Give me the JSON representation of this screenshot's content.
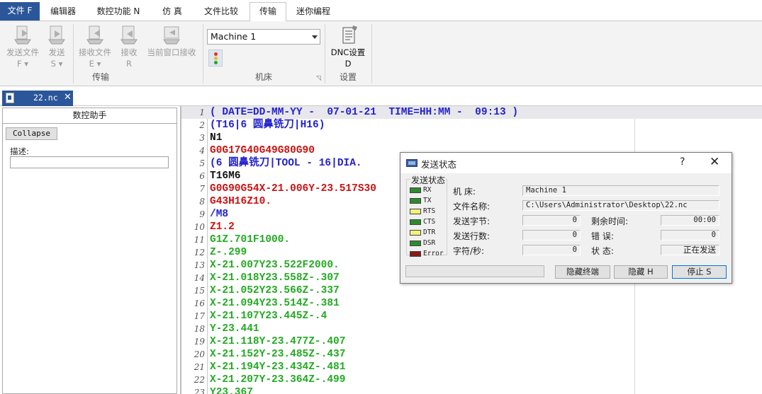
{
  "menu": {
    "tabs": [
      {
        "label": "文件 F",
        "kind": "file"
      },
      {
        "label": "编辑器"
      },
      {
        "label": "数控功能 N"
      },
      {
        "label": "仿 真"
      },
      {
        "label": "文件比较"
      },
      {
        "label": "传输",
        "active": true
      },
      {
        "label": "迷你编程"
      }
    ]
  },
  "ribbon": {
    "send_file": {
      "label": "发送文件",
      "key": "F",
      "icon": "send-file-icon"
    },
    "send": {
      "label": "发送",
      "key": "S",
      "icon": "send-icon"
    },
    "receive_file": {
      "label": "接收文件",
      "key": "E",
      "icon": "receive-file-icon"
    },
    "receive": {
      "label": "接收",
      "key": "R",
      "icon": "receive-icon"
    },
    "receive_current": {
      "label": "当前窗口接收",
      "icon": "receive-window-icon"
    },
    "group_transfer": "传输",
    "machine_value": "Machine 1",
    "group_machine": "机床",
    "dnc_settings": {
      "label": "DNC设置",
      "key": "D",
      "icon": "dnc-settings-icon"
    },
    "group_settings": "设置"
  },
  "document_tab": {
    "name": "22.nc",
    "icon": "nc-file-icon"
  },
  "assistant": {
    "title": "数控助手",
    "collapse_label": "Collapse",
    "description_label": "描述:",
    "description_value": ""
  },
  "code_lines": [
    {
      "n": "1",
      "text": "( DATE=DD-MM-YY -  07-01-21  TIME=HH:MM -  09:13 )",
      "color": "#2222cc"
    },
    {
      "n": "2",
      "text": "(T16|6 圆鼻铣刀|H16)",
      "color": "#2222cc"
    },
    {
      "n": "3",
      "text": "N1",
      "color": "#111111"
    },
    {
      "n": "4",
      "text": "G0G17G40G49G80G90",
      "color": "#cc1111"
    },
    {
      "n": "5",
      "text": "(6 圆鼻铣刀|TOOL - 16|DIA.",
      "color": "#2222cc"
    },
    {
      "n": "6",
      "text": "T16M6",
      "color": "#111111"
    },
    {
      "n": "7",
      "text": "G0G90G54X-21.006Y-23.517S30",
      "color": "#cc1111"
    },
    {
      "n": "8",
      "text": "G43H16Z10.",
      "color": "#cc1111"
    },
    {
      "n": "9",
      "text": "/M8",
      "color": "#2222cc"
    },
    {
      "n": "10",
      "text": "Z1.2",
      "color": "#cc1111"
    },
    {
      "n": "11",
      "text": "G1Z.701F1000.",
      "color": "#22aa22"
    },
    {
      "n": "12",
      "text": "Z-.299",
      "color": "#22aa22"
    },
    {
      "n": "13",
      "text": "X-21.007Y23.522F2000.",
      "color": "#22aa22"
    },
    {
      "n": "14",
      "text": "X-21.018Y23.558Z-.307",
      "color": "#22aa22"
    },
    {
      "n": "15",
      "text": "X-21.052Y23.566Z-.337",
      "color": "#22aa22"
    },
    {
      "n": "16",
      "text": "X-21.094Y23.514Z-.381",
      "color": "#22aa22"
    },
    {
      "n": "17",
      "text": "X-21.107Y23.445Z-.4",
      "color": "#22aa22"
    },
    {
      "n": "18",
      "text": "Y-23.441",
      "color": "#22aa22"
    },
    {
      "n": "19",
      "text": "X-21.118Y-23.477Z-.407",
      "color": "#22aa22"
    },
    {
      "n": "20",
      "text": "X-21.152Y-23.485Z-.437",
      "color": "#22aa22"
    },
    {
      "n": "21",
      "text": "X-21.194Y-23.434Z-.481",
      "color": "#22aa22"
    },
    {
      "n": "22",
      "text": "X-21.207Y-23.364Z-.499",
      "color": "#22aa22"
    },
    {
      "n": "23",
      "text": "Y23.367",
      "color": "#22aa22"
    }
  ],
  "dialog": {
    "title": "发送状态",
    "help": "?",
    "close": "✕",
    "status_group": "发送状态",
    "signals": [
      {
        "name": "RX",
        "color": "#2f8a2f"
      },
      {
        "name": "TX",
        "color": "#2f8a2f"
      },
      {
        "name": "RTS",
        "color": "#f2f27a"
      },
      {
        "name": "CTS",
        "color": "#2f8a2f"
      },
      {
        "name": "DTR",
        "color": "#f2f27a"
      },
      {
        "name": "DSR",
        "color": "#2f8a2f"
      },
      {
        "name": "Error",
        "color": "#8a1a1a"
      }
    ],
    "machine_label": "机    床:",
    "machine_value": "Machine 1",
    "filename_label": "文件名称:",
    "filename_value": "C:\\Users\\Administrator\\Desktop\\22.nc",
    "bytes_label": "发送字节:",
    "bytes_value": "0",
    "remaining_label": "剩余时间:",
    "remaining_value": "00:00",
    "lines_label": "发送行数:",
    "lines_value": "0",
    "errors_label": "错    误:",
    "errors_value": "0",
    "rate_label": "字符/秒:",
    "rate_value": "0",
    "state_label": "状    态:",
    "state_value": "正在发送",
    "progress": 0,
    "hide_terminal": "隐藏终端",
    "hide": "隐藏 H",
    "stop": "停止 S"
  }
}
